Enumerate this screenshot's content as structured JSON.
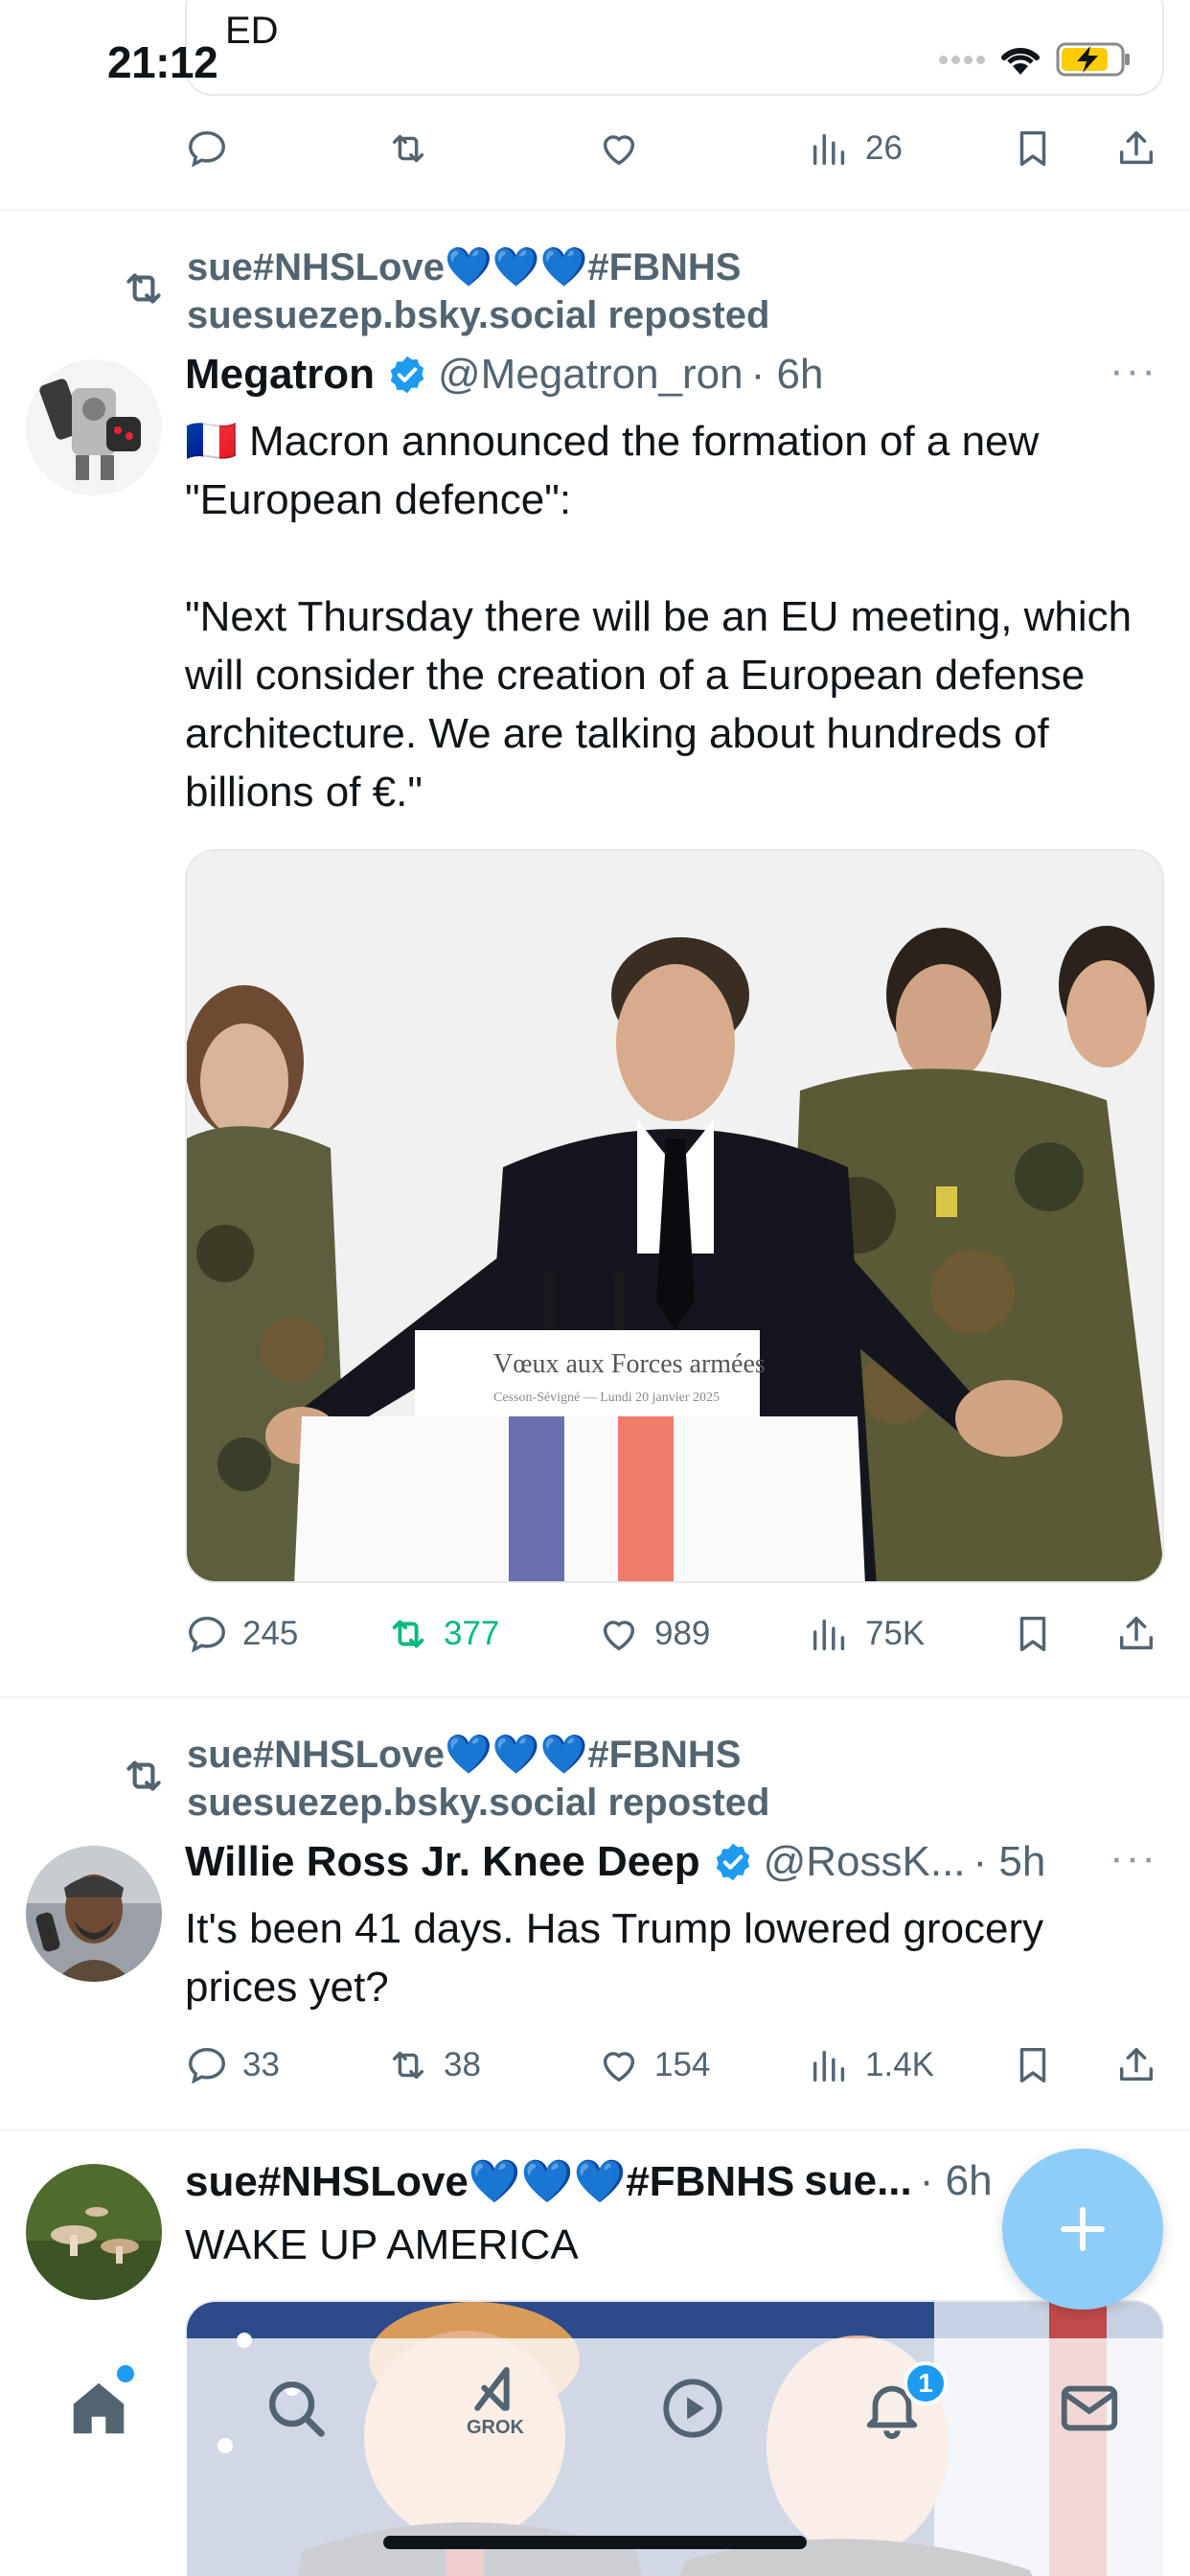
{
  "status_bar": {
    "time": "21:12",
    "carrier": "ED"
  },
  "top_tweet": {
    "views": "26"
  },
  "tweets": [
    {
      "repost_by": "sue#NHSLove💙💙💙#FBNHS\nsuesuezep.bsky.social reposted",
      "name": "Megatron",
      "handle": "@Megatron_ron",
      "time": "· 6h",
      "text": "🇫🇷 Macron announced the formation of a new \"European defence\":\n\n\"Next Thursday there will be an EU meeting, which will consider the creation of a European defense architecture. We are talking about hundreds of billions of €.\"",
      "media_caption": "Vœux aux Forces armées",
      "media_subcaption": "Cesson-Sévigné — Lundi 20 janvier 2025",
      "replies": "245",
      "reposts": "377",
      "likes": "989",
      "views": "75K"
    },
    {
      "repost_by": "sue#NHSLove💙💙💙#FBNHS\nsuesuezep.bsky.social reposted",
      "name": "Willie Ross Jr. Knee Deep",
      "handle": "@RossK...",
      "time": "· 5h",
      "text": "It's been 41 days. Has Trump lowered grocery prices yet?",
      "replies": "33",
      "reposts": "38",
      "likes": "154",
      "views": "1.4K"
    },
    {
      "name": "sue#NHSLove💙💙💙#FBNHS",
      "handle": "sue...",
      "time": "· 6h",
      "text": "WAKE UP AMERICA"
    }
  ],
  "tabbar": {
    "grok_label": "GROK",
    "notification_count": "1"
  },
  "colors": {
    "accent": "#1d9bf0",
    "repost_green": "#00ba7c",
    "muted": "#536471"
  }
}
